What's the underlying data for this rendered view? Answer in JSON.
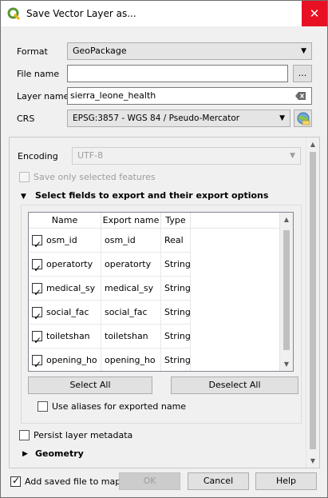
{
  "window": {
    "title": "Save Vector Layer as...",
    "close_glyph": "✕"
  },
  "form": {
    "format_label": "Format",
    "format_value": "GeoPackage",
    "filename_label": "File name",
    "filename_value": "",
    "browse_label": "...",
    "layername_label": "Layer name",
    "layername_value": "sierra_leone_health",
    "crs_label": "CRS",
    "crs_value": "EPSG:3857 - WGS 84 / Pseudo-Mercator"
  },
  "options": {
    "encoding_label": "Encoding",
    "encoding_value": "UTF-8",
    "save_selected_label": "Save only selected features",
    "fields_section_title": "Select fields to export and their export options",
    "table_headers": {
      "name": "Name",
      "export_name": "Export name",
      "type": "Type"
    },
    "fields": [
      {
        "name": "osm_id",
        "export_name": "osm_id",
        "type": "Real",
        "checked": true
      },
      {
        "name": "operatorty",
        "export_name": "operatorty",
        "type": "String",
        "checked": true
      },
      {
        "name": "medical_sy",
        "export_name": "medical_sy",
        "type": "String",
        "checked": true
      },
      {
        "name": "social_fac",
        "export_name": "social_fac",
        "type": "String",
        "checked": true
      },
      {
        "name": "toiletshan",
        "export_name": "toiletshan",
        "type": "String",
        "checked": true
      },
      {
        "name": "opening_ho",
        "export_name": "opening_ho",
        "type": "String",
        "checked": true
      }
    ],
    "select_all_label": "Select All",
    "deselect_all_label": "Deselect All",
    "use_aliases_label": "Use aliases for exported name",
    "persist_metadata_label": "Persist layer metadata",
    "geometry_section_title": "Geometry"
  },
  "footer": {
    "add_saved_label": "Add saved file to map",
    "add_saved_checked": true,
    "ok_label": "OK",
    "cancel_label": "Cancel",
    "help_label": "Help"
  },
  "colors": {
    "close_bg": "#e81123",
    "qgis_green": "#589632",
    "qgis_yellow": "#ee7913"
  }
}
